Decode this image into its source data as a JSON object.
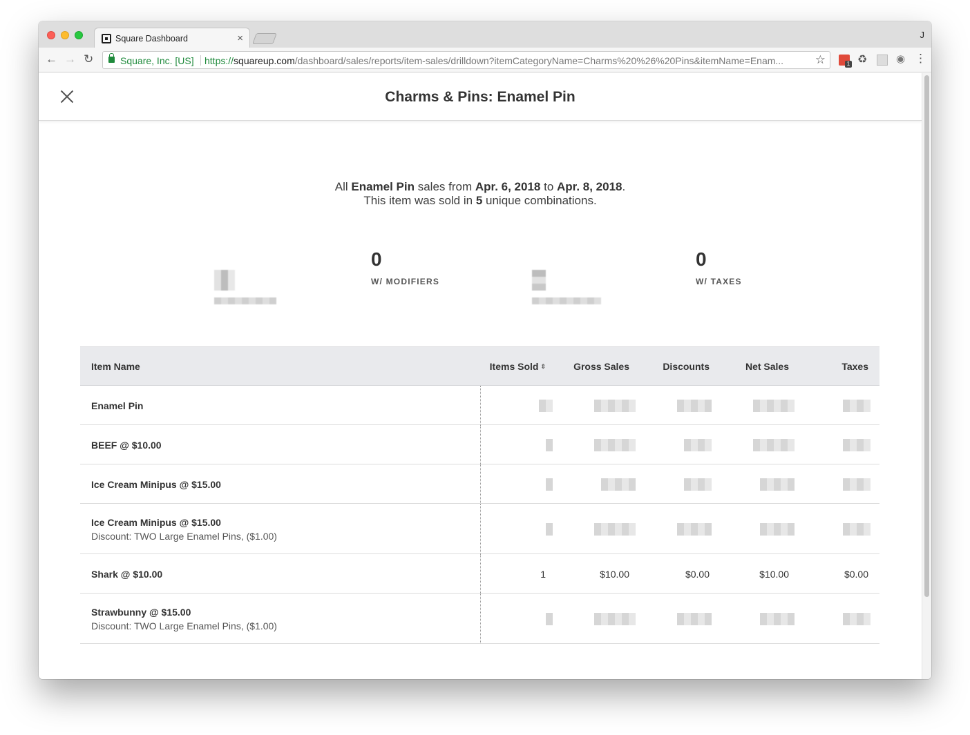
{
  "browser": {
    "tab_title": "Square Dashboard",
    "profile_initial": "J",
    "secure_label": "Square, Inc. [US]",
    "url_protocol": "https://",
    "url_host": "squareup.com",
    "url_path": "/dashboard/sales/reports/item-sales/drilldown?itemCategoryName=Charms%20%26%20Pins&itemName=Enam..."
  },
  "modal": {
    "title": "Charms & Pins: Enamel Pin"
  },
  "summary": {
    "line1_pre": "All ",
    "item_name": "Enamel Pin",
    "line1_mid": " sales from ",
    "date_from": "Apr. 6, 2018",
    "line1_to": " to ",
    "date_to": "Apr. 8, 2018",
    "line1_end": ".",
    "line2_pre": "This item was sold in ",
    "combinations": "5",
    "line2_end": " unique combinations."
  },
  "stats": [
    {
      "value": "0",
      "label": "W/ MODIFIERS"
    },
    {
      "value": "0",
      "label": "W/ TAXES"
    }
  ],
  "table": {
    "headers": {
      "item_name": "Item Name",
      "items_sold": "Items Sold",
      "gross_sales": "Gross Sales",
      "discounts": "Discounts",
      "net_sales": "Net Sales",
      "taxes": "Taxes"
    },
    "rows": [
      {
        "name": "Enamel Pin"
      },
      {
        "name": "BEEF @ $10.00"
      },
      {
        "name": "Ice Cream Minipus @ $15.00"
      },
      {
        "name": "Ice Cream Minipus @ $15.00",
        "sub": "Discount: TWO Large Enamel Pins, ($1.00)"
      },
      {
        "name": "Shark @ $10.00",
        "items_sold": "1",
        "gross_sales": "$10.00",
        "discounts": "$0.00",
        "net_sales": "$10.00",
        "taxes": "$0.00"
      },
      {
        "name": "Strawbunny @ $15.00",
        "sub": "Discount: TWO Large Enamel Pins, ($1.00)"
      }
    ]
  },
  "colors": {
    "secure_green": "#1f8a3c",
    "header_bg": "#e9eaed",
    "text_dark": "#333333"
  },
  "icons": [
    "close-icon",
    "back-icon",
    "forward-icon",
    "reload-icon",
    "lock-icon",
    "star-icon",
    "menu-icon",
    "sort-icon"
  ]
}
